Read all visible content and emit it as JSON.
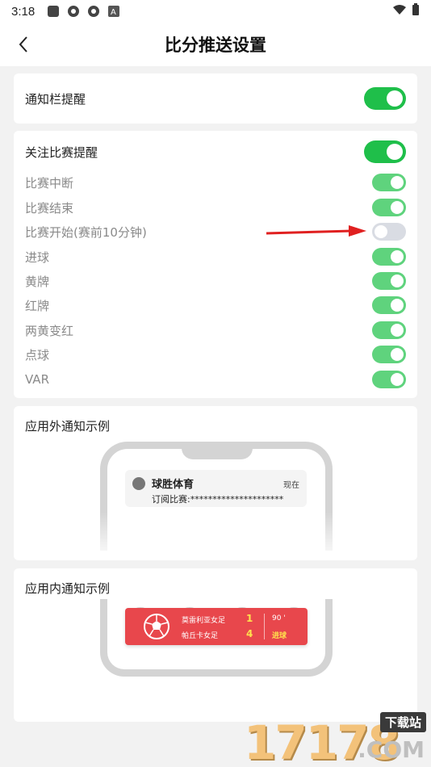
{
  "status_bar": {
    "time": "3:18",
    "icons": [
      "square-app-icon",
      "aperture-icon",
      "aperture-icon",
      "a-icon"
    ],
    "right_icons": [
      "wifi-icon",
      "battery-icon"
    ]
  },
  "header": {
    "title": "比分推送设置",
    "back_icon": "chevron-left-icon"
  },
  "notification_bar": {
    "label": "通知栏提醒",
    "enabled": true
  },
  "followed_match": {
    "label": "关注比赛提醒",
    "enabled": true,
    "items": [
      {
        "label": "比赛中断",
        "enabled": true
      },
      {
        "label": "比赛结束",
        "enabled": true
      },
      {
        "label": "比赛开始(赛前10分钟)",
        "enabled": false
      },
      {
        "label": "进球",
        "enabled": true
      },
      {
        "label": "黄牌",
        "enabled": true
      },
      {
        "label": "红牌",
        "enabled": true
      },
      {
        "label": "两黄变红",
        "enabled": true
      },
      {
        "label": "点球",
        "enabled": true
      },
      {
        "label": "VAR",
        "enabled": true
      }
    ]
  },
  "outside_example": {
    "title": "应用外通知示例",
    "app_name": "球胜体育",
    "time": "现在",
    "text": "订阅比赛:*********************"
  },
  "inside_example": {
    "title": "应用内通知示例",
    "home_team": "莫雷利亚女足",
    "away_team": "帕丘卡女足",
    "home_score": "1",
    "away_score": "4",
    "minute": "90 '",
    "event": "进球"
  },
  "watermark": {
    "digits": "17178",
    "badge": "下载站",
    "suffix": ".COM"
  },
  "colors": {
    "toggle_on": "#1fbf4a",
    "toggle_on_light": "#5fd37d",
    "toggle_off": "#d9dce3",
    "banner": "#e8474c",
    "arrow": "#e02020"
  }
}
